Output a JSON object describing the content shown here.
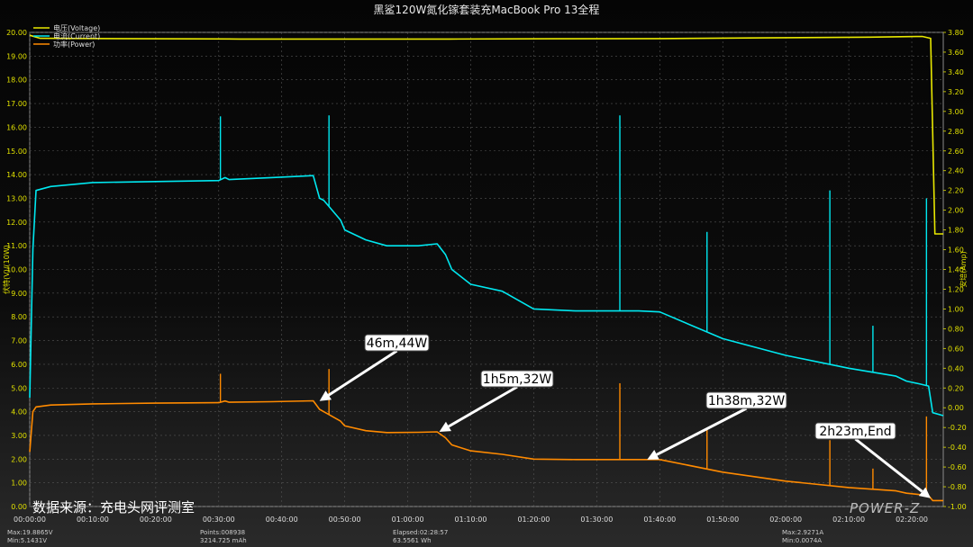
{
  "chart_data": {
    "type": "line",
    "title": "黑鲨120W氮化镓套装充MacBook Pro 13全程",
    "ylabel_left": "伏特(V)/(10W)",
    "ylabel_right": "安培(Amp)",
    "xlim": [
      0,
      8700
    ],
    "ylim_left": [
      0,
      20
    ],
    "ylim_right": [
      -1.0,
      3.8
    ],
    "x_ticks": [
      "00:00:00",
      "00:10:00",
      "00:20:00",
      "00:30:00",
      "00:40:00",
      "00:50:00",
      "01:00:00",
      "01:10:00",
      "01:20:00",
      "01:30:00",
      "01:40:00",
      "01:50:00",
      "02:00:00",
      "02:10:00",
      "02:20:00"
    ],
    "y_ticks_left": [
      "0.00",
      "1.00",
      "2.00",
      "3.00",
      "4.00",
      "5.00",
      "6.00",
      "7.00",
      "8.00",
      "9.00",
      "10.00",
      "11.00",
      "12.00",
      "13.00",
      "14.00",
      "15.00",
      "16.00",
      "17.00",
      "18.00",
      "19.00",
      "20.00"
    ],
    "y_ticks_right": [
      "-1.00",
      "-0.80",
      "-0.60",
      "-0.40",
      "-0.20",
      "0.00",
      "0.20",
      "0.40",
      "0.60",
      "0.80",
      "1.00",
      "1.20",
      "1.40",
      "1.60",
      "1.80",
      "2.00",
      "2.20",
      "2.40",
      "2.60",
      "2.80",
      "3.00",
      "3.20",
      "3.40",
      "3.60",
      "3.80"
    ],
    "legend": [
      {
        "name": "电压(Voltage)",
        "color": "#e8e800"
      },
      {
        "name": "电流(Current)",
        "color": "#00e8f0"
      },
      {
        "name": "功率(Power)",
        "color": "#ff8a00"
      }
    ],
    "series": [
      {
        "name": "电压(Voltage)",
        "axis": "left",
        "color": "#e8e800",
        "x": [
          0,
          100,
          2000,
          4000,
          5000,
          6000,
          7000,
          8000,
          8500,
          8580,
          8620,
          8700
        ],
        "y": [
          19.88,
          19.75,
          19.72,
          19.72,
          19.73,
          19.74,
          19.77,
          19.8,
          19.83,
          19.75,
          11.5,
          11.5
        ]
      },
      {
        "name": "电流(Current)",
        "axis": "right",
        "color": "#00e8f0",
        "x": [
          0,
          30,
          60,
          200,
          600,
          1200,
          1800,
          1860,
          1900,
          2300,
          2700,
          2760,
          2800,
          2840,
          2960,
          3000,
          3200,
          3400,
          3700,
          3880,
          3960,
          4020,
          4200,
          4500,
          4800,
          5200,
          5500,
          5800,
          6000,
          6600,
          7200,
          7800,
          8250,
          8350,
          8480,
          8560,
          8600,
          8700
        ],
        "y": [
          0.1,
          1.6,
          2.2,
          2.24,
          2.28,
          2.29,
          2.3,
          2.33,
          2.31,
          2.33,
          2.35,
          2.12,
          2.1,
          2.05,
          1.9,
          1.8,
          1.7,
          1.64,
          1.64,
          1.66,
          1.55,
          1.4,
          1.25,
          1.18,
          1.0,
          0.98,
          0.98,
          0.98,
          0.97,
          0.7,
          0.53,
          0.4,
          0.32,
          0.27,
          0.24,
          0.22,
          -0.05,
          -0.08
        ]
      },
      {
        "name": "功率(Power)",
        "axis": "left",
        "color": "#ff8a00",
        "x": [
          0,
          30,
          60,
          200,
          600,
          1200,
          1800,
          1860,
          1900,
          2300,
          2700,
          2760,
          2800,
          2840,
          2960,
          3000,
          3200,
          3400,
          3700,
          3880,
          3960,
          4020,
          4200,
          4500,
          4800,
          5200,
          5500,
          5800,
          6000,
          6600,
          7200,
          7800,
          8250,
          8350,
          8480,
          8560,
          8600,
          8700
        ],
        "y": [
          2.3,
          4.0,
          4.2,
          4.28,
          4.33,
          4.36,
          4.38,
          4.45,
          4.4,
          4.42,
          4.46,
          4.1,
          4.0,
          3.9,
          3.6,
          3.4,
          3.2,
          3.12,
          3.13,
          3.15,
          2.9,
          2.6,
          2.35,
          2.2,
          2.0,
          1.98,
          1.98,
          1.98,
          1.98,
          1.45,
          1.07,
          0.8,
          0.66,
          0.56,
          0.5,
          0.46,
          0.25,
          0.25
        ]
      }
    ],
    "spikes": [
      {
        "series": "电流(Current)",
        "x": 1816,
        "y": 2.95
      },
      {
        "series": "电流(Current)",
        "x": 2850,
        "y": 2.96
      },
      {
        "series": "电流(Current)",
        "x": 5620,
        "y": 2.96
      },
      {
        "series": "电流(Current)",
        "x": 6450,
        "y": 1.78
      },
      {
        "series": "电流(Current)",
        "x": 7620,
        "y": 2.2
      },
      {
        "series": "电流(Current)",
        "x": 8030,
        "y": 0.83
      },
      {
        "series": "电流(Current)",
        "x": 8540,
        "y": 2.12
      },
      {
        "series": "功率(Power)",
        "x": 1816,
        "y": 5.6
      },
      {
        "series": "功率(Power)",
        "x": 2850,
        "y": 5.8
      },
      {
        "series": "功率(Power)",
        "x": 5620,
        "y": 5.2
      },
      {
        "series": "功率(Power)",
        "x": 6450,
        "y": 3.3
      },
      {
        "series": "功率(Power)",
        "x": 7620,
        "y": 2.8
      },
      {
        "series": "功率(Power)",
        "x": 8030,
        "y": 1.6
      },
      {
        "series": "功率(Power)",
        "x": 8540,
        "y": 3.8
      }
    ],
    "annotations": [
      {
        "text": "46m,44W",
        "x": 2760,
        "y": 4.45
      },
      {
        "text": "1h5m,32W",
        "x": 3900,
        "y": 3.15
      },
      {
        "text": "1h38m,32W",
        "x": 5880,
        "y": 1.98
      },
      {
        "text": "2h23m,End",
        "x": 8580,
        "y": 0.35
      }
    ],
    "grid": true,
    "legend_position": "top-left"
  },
  "stats": {
    "max_v": "Max:19.8865V",
    "min_v": "Min:5.1431V",
    "points": "Points:008938",
    "capacity": "3214.725 mAh",
    "elapsed": "Elapsed:02:28:57",
    "energy": "63.5561 Wh",
    "max_a": "Max:2.9271A",
    "min_a": "Min:0.0074A"
  },
  "source": "数据来源：充电头网评测室",
  "brand": "POWER-Z"
}
